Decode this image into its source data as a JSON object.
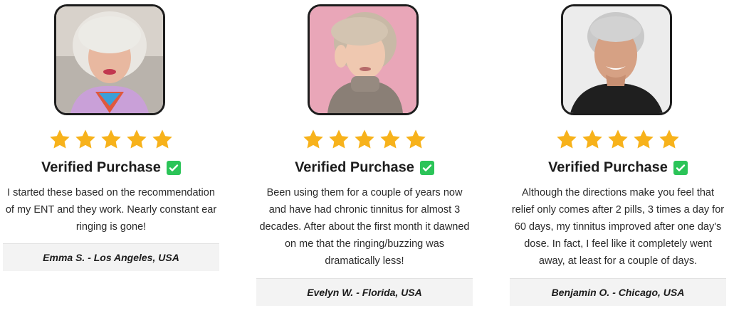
{
  "reviews": [
    {
      "verified_label": "Verified Purchase",
      "rating": 5,
      "quote": "I started these based on the recommendation of my ENT and they work. Nearly constant ear ringing is gone!",
      "author": "Emma S. - Los Angeles, USA"
    },
    {
      "verified_label": "Verified Purchase",
      "rating": 5,
      "quote": "Been using them for a couple of years now and have had chronic tinnitus for almost 3 decades. After about the first month it dawned on me that the ringing/buzzing was dramatically less!",
      "author": "Evelyn W. - Florida, USA"
    },
    {
      "verified_label": "Verified Purchase",
      "rating": 5,
      "quote": "Although the directions make you feel that relief only comes after 2 pills, 3 times a day for 60 days, my tinnitus improved after one day's dose. In fact, I feel like it completely went away, at least for a couple of days.",
      "author": "Benjamin O. - Chicago, USA"
    }
  ],
  "colors": {
    "star": "#f7b21b",
    "check": "#2bc458",
    "author_bg": "#f3f3f3"
  },
  "icons": {
    "star": "star-icon",
    "check": "checkmark-icon"
  }
}
